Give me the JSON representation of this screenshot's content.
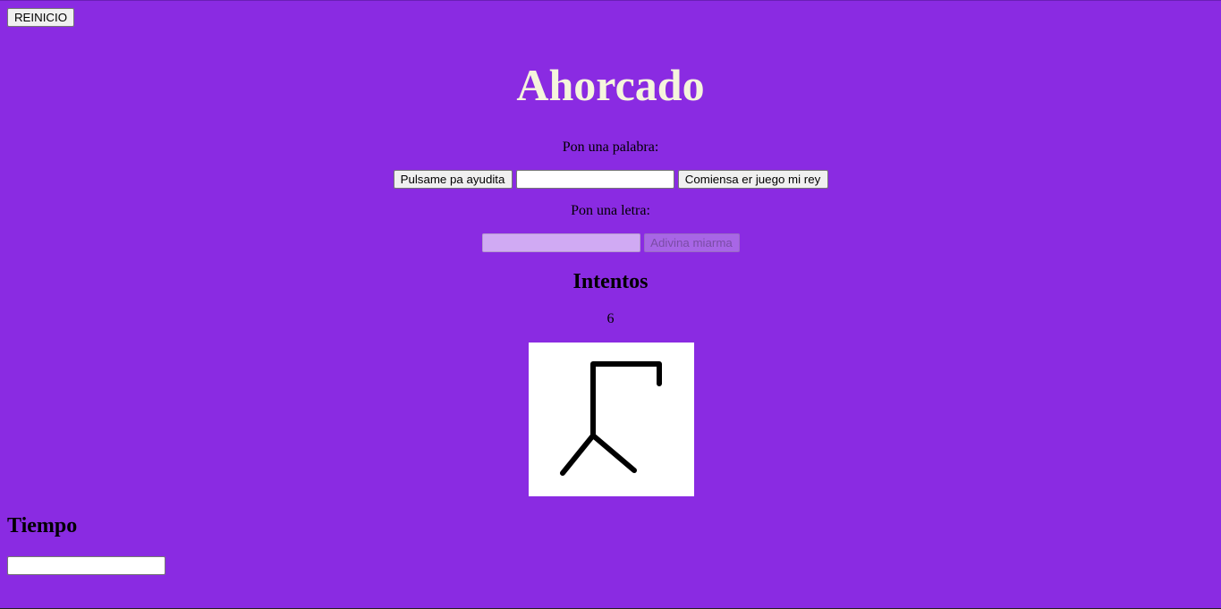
{
  "header": {
    "reset_label": "REINICIO",
    "title": "Ahorcado"
  },
  "word_section": {
    "prompt": "Pon una palabra:",
    "help_label": "Pulsame pa ayudita",
    "word_value": "",
    "start_label": "Comiensa er juego mi rey"
  },
  "letter_section": {
    "prompt": "Pon una letra:",
    "letter_value": "",
    "guess_label": "Adivina miarma"
  },
  "attempts": {
    "heading": "Intentos",
    "value": "6"
  },
  "time": {
    "heading": "Tiempo",
    "value": ""
  },
  "colors": {
    "background": "#8a2be2",
    "title": "#f5f5dc"
  },
  "icons": {
    "hangman": "gallows-icon"
  }
}
